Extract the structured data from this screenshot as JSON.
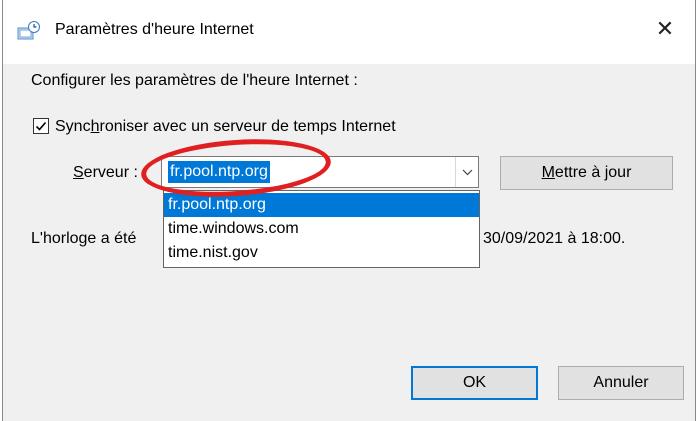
{
  "dialog": {
    "title": "Paramètres d'heure Internet",
    "close_glyph": "✕"
  },
  "content": {
    "heading": "Configurer les paramètres de l'heure Internet :",
    "sync_checkbox": {
      "checked": true,
      "label_prefix": "Sync",
      "label_accel": "h",
      "label_suffix": "roniser avec un serveur de temps Internet"
    },
    "server": {
      "label_accel": "S",
      "label_rest": "erveur :",
      "selected_value": "fr.pool.ntp.org",
      "options": [
        "fr.pool.ntp.org",
        "time.windows.com",
        "time.nist.gov"
      ]
    },
    "update_button": {
      "accel": "M",
      "rest": "ettre à jour"
    },
    "status_prefix": "L'horloge a été",
    "status_suffix": "30/09/2021 à 18:00."
  },
  "buttons": {
    "ok": "OK",
    "cancel": "Annuler"
  },
  "colors": {
    "selection": "#0078d7",
    "annotation": "#e02020"
  }
}
